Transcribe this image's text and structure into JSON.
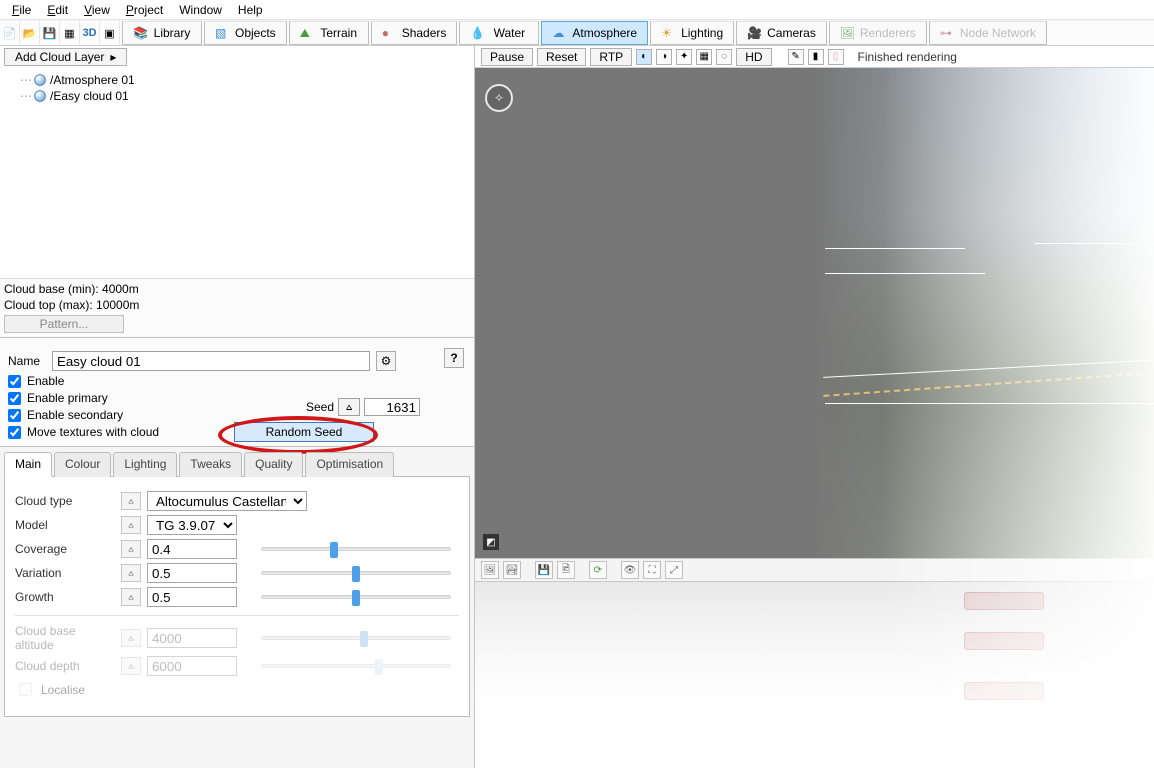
{
  "menu": {
    "file": "File",
    "edit": "Edit",
    "view": "View",
    "project": "Project",
    "window": "Window",
    "help": "Help"
  },
  "cats": {
    "library": "Library",
    "objects": "Objects",
    "terrain": "Terrain",
    "shaders": "Shaders",
    "water": "Water",
    "atmosphere": "Atmosphere",
    "lighting": "Lighting",
    "cameras": "Cameras",
    "renderers": "Renderers",
    "node_network": "Node Network"
  },
  "add_cloud": "Add Cloud Layer",
  "render_ctrl": {
    "pause": "Pause",
    "reset": "Reset",
    "rtp": "RTP",
    "hd": "HD",
    "status": "Finished rendering"
  },
  "tree": {
    "items": [
      "/Atmosphere 01",
      "/Easy cloud 01"
    ]
  },
  "info": {
    "cloud_base": "Cloud base (min): 4000m",
    "cloud_top": "Cloud top (max): 10000m",
    "pattern": "Pattern..."
  },
  "editor": {
    "name_label": "Name",
    "name_value": "Easy cloud 01",
    "enable": "Enable",
    "enable_primary": "Enable primary",
    "enable_secondary": "Enable secondary",
    "move_textures": "Move textures with cloud",
    "seed_label": "Seed",
    "seed_value": "1631",
    "random_seed": "Random Seed",
    "help": "?"
  },
  "tabs": {
    "main": "Main",
    "colour": "Colour",
    "lighting": "Lighting",
    "tweaks": "Tweaks",
    "quality": "Quality",
    "optimisation": "Optimisation"
  },
  "params": {
    "cloud_type_label": "Cloud type",
    "cloud_type_value": "Altocumulus Castellanus",
    "model_label": "Model",
    "model_value": "TG 3.9.07",
    "coverage_label": "Coverage",
    "coverage_value": "0.4",
    "variation_label": "Variation",
    "variation_value": "0.5",
    "growth_label": "Growth",
    "growth_value": "0.5",
    "cloud_base_alt_label": "Cloud base altitude",
    "cloud_base_alt_value": "4000",
    "cloud_depth_label": "Cloud depth",
    "cloud_depth_value": "6000",
    "localise_label": "Localise"
  }
}
